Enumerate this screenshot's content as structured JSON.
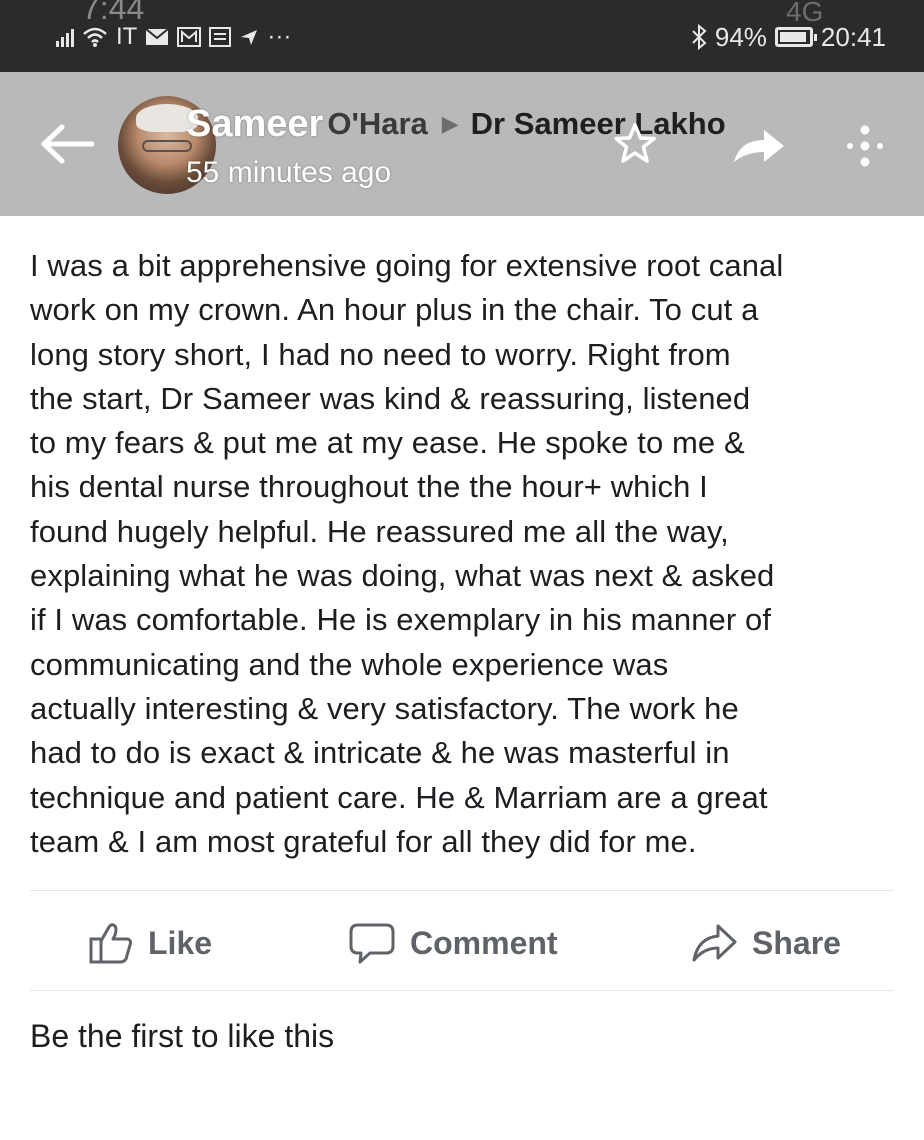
{
  "status_bar": {
    "ghost_time": "7:44",
    "carrier": "IT",
    "overflow": "···",
    "ghost_network": "4G",
    "battery_percent": "94%",
    "time": "20:41"
  },
  "header": {
    "author": "Sameer",
    "author_overlap": "O'Hara",
    "recipient": "Dr Sameer Lakho",
    "timestamp": "55 minutes ago",
    "icons": [
      "back-arrow-icon",
      "star-icon",
      "share-arrow-icon",
      "more-vertical-icon"
    ]
  },
  "post": {
    "lines": [
      "I was a bit apprehensive going for extensive root canal",
      "work on my crown. An hour plus in the chair. To cut a",
      "long story short, I had no need to worry. Right from",
      "the start, Dr Sameer was kind & reassuring, listened",
      "to my fears & put me at my ease. He spoke to me &",
      "his dental nurse throughout the the hour+ which I",
      "found hugely helpful. He reassured me all the way,",
      "explaining what he was doing, what was next & asked",
      "if I was comfortable. He is exemplary in his manner of",
      "communicating and the whole experience was",
      "actually interesting & very satisfactory. The work he",
      "had to do is exact & intricate & he was masterful in",
      "technique and patient care. He & Marriam are a great",
      "team & I am most grateful for all they did for me."
    ]
  },
  "actions": {
    "like_label": "Like",
    "comment_label": "Comment",
    "share_label": "Share"
  },
  "footer": {
    "likes_text": "Be the first to like this"
  },
  "colors": {
    "status_bar_bg": "#2b2b2b",
    "header_bg": "#b9b9b9",
    "action_text": "#5f6368",
    "body_text": "#1c1e21"
  }
}
